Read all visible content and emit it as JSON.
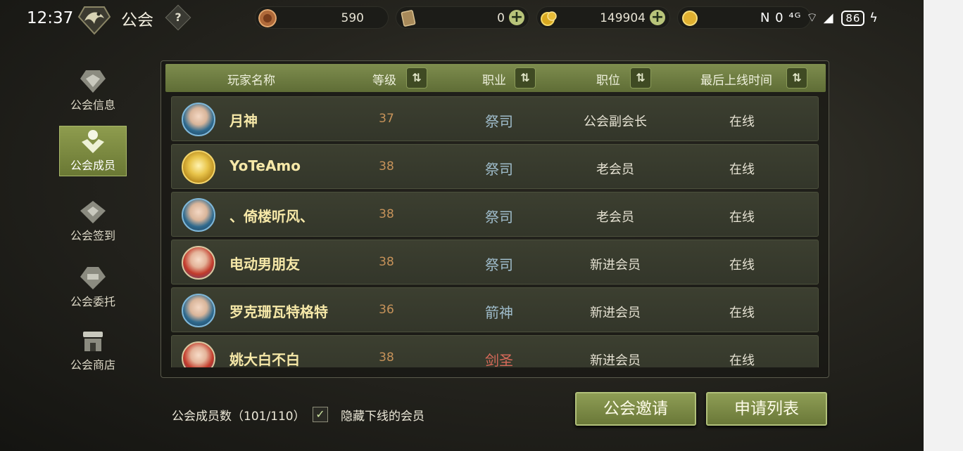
{
  "status_bar": {
    "time": "12:37",
    "indicators": "N 0 ⁴ᴳ",
    "battery": "86",
    "icons": [
      "wifi-icon",
      "signal-icon",
      "charging-icon"
    ]
  },
  "header": {
    "title": "公会",
    "help_label": "?",
    "currencies": [
      {
        "icon": "coin-medal-icon",
        "value": "590",
        "has_plus": false
      },
      {
        "icon": "ticket-card-icon",
        "value": "0",
        "has_plus": true
      },
      {
        "icon": "gold-coins-icon",
        "value": "149904",
        "has_plus": true
      },
      {
        "icon": "gold-coin-icon",
        "value": "",
        "has_plus": false
      }
    ]
  },
  "nav": {
    "items": [
      {
        "label": "公会信息",
        "icon": "guild-info-icon",
        "active": false
      },
      {
        "label": "公会成员",
        "icon": "guild-members-icon",
        "active": true
      },
      {
        "label": "公会签到",
        "icon": "guild-checkin-icon",
        "active": false
      },
      {
        "label": "公会委托",
        "icon": "guild-commission-icon",
        "active": false
      },
      {
        "label": "公会商店",
        "icon": "shop-icon",
        "active": false
      }
    ]
  },
  "table": {
    "columns": {
      "name": "玩家名称",
      "level": "等级",
      "job": "职业",
      "position": "职位",
      "last_online": "最后上线时间"
    },
    "sort_icon": "⇅",
    "rows": [
      {
        "name": "月神",
        "level": "37",
        "job": "祭司",
        "position": "公会副会长",
        "last_online": "在线",
        "avatar": "blue"
      },
      {
        "name": "YoTeAmo",
        "level": "38",
        "job": "祭司",
        "position": "老会员",
        "last_online": "在线",
        "avatar": "gold"
      },
      {
        "name": "、倚楼听风、",
        "level": "38",
        "job": "祭司",
        "position": "老会员",
        "last_online": "在线",
        "avatar": "blue"
      },
      {
        "name": "电动男朋友",
        "level": "38",
        "job": "祭司",
        "position": "新进会员",
        "last_online": "在线",
        "avatar": "red"
      },
      {
        "name": "罗克珊瓦特格特",
        "level": "36",
        "job": "箭神",
        "position": "新进会员",
        "last_online": "在线",
        "avatar": "blue"
      },
      {
        "name": "姚大白不白",
        "level": "38",
        "job": "剑圣",
        "position": "新进会员",
        "last_online": "在线",
        "avatar": "red"
      }
    ]
  },
  "footer": {
    "member_count": "公会成员数（101/110）",
    "hide_offline_checked": true,
    "check_mark": "✓",
    "hide_offline_label": "隐藏下线的会员",
    "invite_button": "公会邀请",
    "apply_list_button": "申请列表"
  },
  "colors": {
    "accent": "#7e8d4e",
    "name_text": "#f6e8a8",
    "level_text": "#c7935a",
    "job_text": "#9fbccb",
    "job_text_warrior": "#d86a5a"
  }
}
